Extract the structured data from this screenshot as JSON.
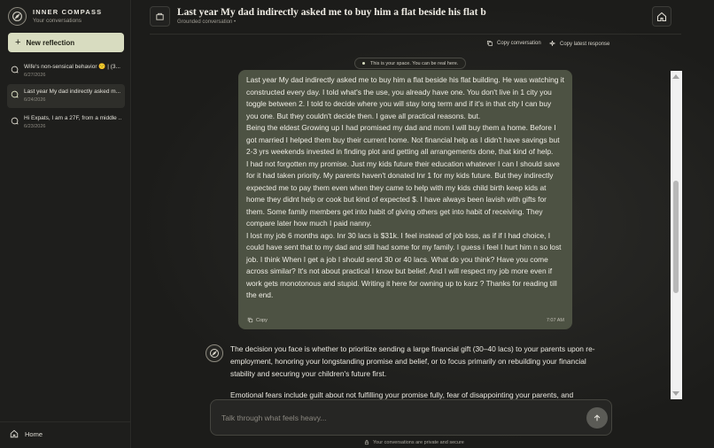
{
  "brand": {
    "name": "INNER COMPASS",
    "subtitle": "Your conversations"
  },
  "sidebar": {
    "new_label": "New reflection",
    "conversations": [
      {
        "title": "Wife's non-sensical behavior 🙁 | (3...",
        "date": "6/27/2026"
      },
      {
        "title": "Last year My dad indirectly asked m...",
        "date": "6/24/2026"
      },
      {
        "title": "Hi Expats, I am a 27F, from a middle ...",
        "date": "6/23/2026"
      }
    ],
    "home_label": "Home"
  },
  "header": {
    "title": "Last year My dad indirectly asked me to buy him a flat beside his flat b",
    "subtitle": "Grounded conversation •",
    "copy_conversation": "Copy conversation",
    "copy_latest": "Copy latest response"
  },
  "space_notice": "This is your space. You can be real here.",
  "user_message": {
    "text": "Last year My dad indirectly asked me to buy him a flat beside his flat building. He was watching it constructed every day. I told what's the use, you already have one. You don't live in 1 city you toggle between 2. I told to decide where you will stay long term and if it's in that city I can buy you one. But they couldn't decide then. I gave all practical reasons. but.\nBeing the eldest Growing up I had promised my dad and mom I will buy them a home. Before I got married I helped them buy their current home. Not financial help as I didn't have savings but 2-3 yrs weekends invested in finding plot and getting all arrangements done, that kind of help.\nI had not forgotten my promise. Just my kids future their education whatever I can I should save for it had taken priority. My parents haven't donated Inr 1 for my kids future. But they indirectly expected me to pay them even when they came to help with my kids child birth keep kids at home they didnt help or cook but kind of expected $. I have always been lavish with gifts for them. Some family members get into habit of giving others get into habit of receiving. They compare later how much I paid nanny.\nI lost my job 6 months ago. Inr 30 lacs is $31k. I feel instead of job loss, as if if I had choice, I could have sent that to my dad and still had some for my family. I guess i feel I hurt him n so lost job. I think When I get a job I should send 30 or 40 lacs. What do you think? Have you come across similar? It's not about practical I know but belief. And I will respect my job more even if work gets monotonous and stupid. Writing it here for owning up to karz ? Thanks for reading till the end.",
    "copy_label": "Copy",
    "time": "7:07 AM"
  },
  "assistant_message": {
    "paragraph1": "The decision you face is whether to prioritize sending a large financial gift (30–40 lacs) to your parents upon re-employment, honoring your longstanding promise and belief, or to focus primarily on rebuilding your financial stability and securing your children's future first.",
    "paragraph2": "Emotional fears include guilt about not fulfilling your promise fully, fear of disappointing your parents, and"
  },
  "composer": {
    "placeholder": "Talk through what feels heavy...",
    "privacy": "Your conversations are private and secure"
  },
  "colors": {
    "accent": "#d8dcc0",
    "user_bubble": "#4d5243",
    "background": "#1a1a19"
  }
}
